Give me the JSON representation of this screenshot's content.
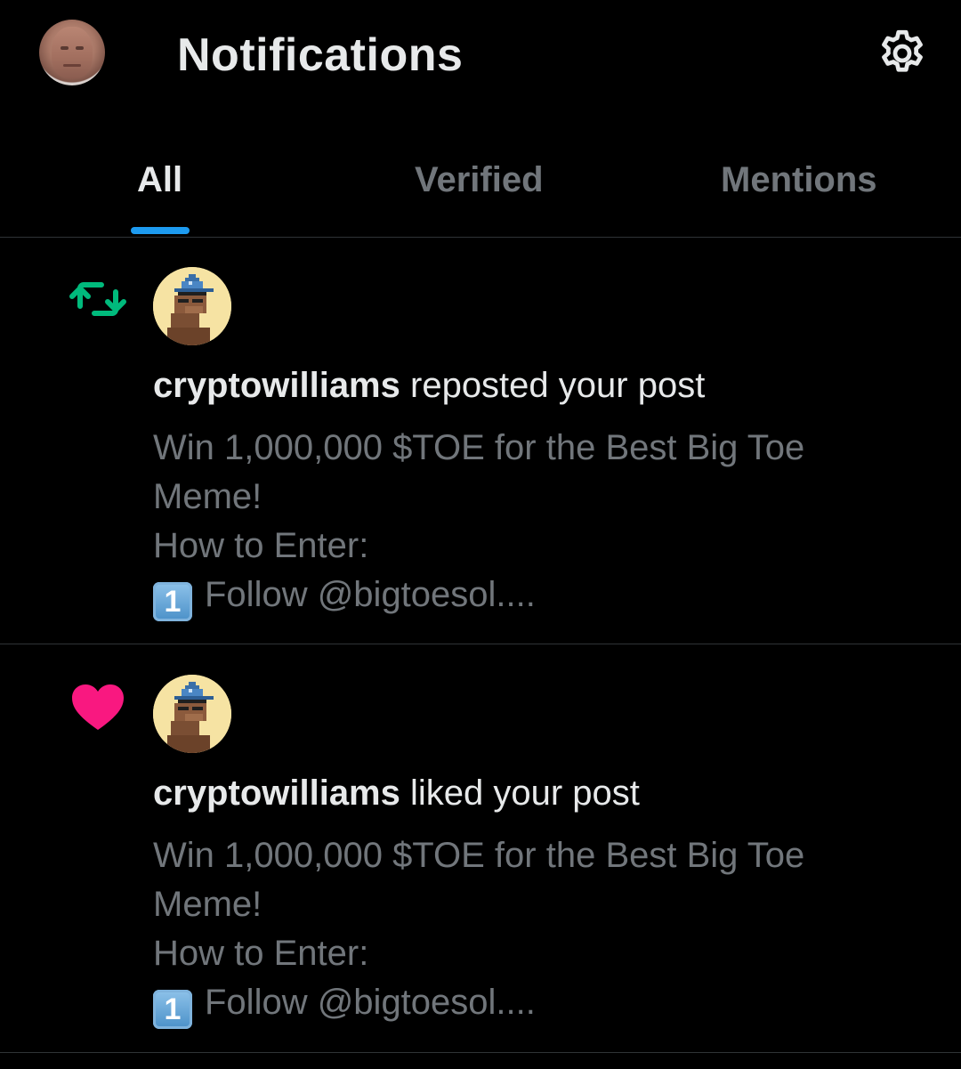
{
  "header": {
    "title": "Notifications",
    "avatar_icon": "user-avatar-icon",
    "settings_icon": "gear-icon"
  },
  "tabs": [
    {
      "label": "All",
      "active": true
    },
    {
      "label": "Verified",
      "active": false
    },
    {
      "label": "Mentions",
      "active": false
    }
  ],
  "colors": {
    "accent": "#1d9bf0",
    "repost": "#00ba7c",
    "like": "#f91880",
    "muted": "#71767b",
    "text": "#e7e9ea",
    "background": "#000000"
  },
  "notifications": [
    {
      "type_icon": "repost-icon",
      "user": "cryptowilliams",
      "action": "reposted your post",
      "body_line1": "Win 1,000,000 $TOE for the Best Big Toe Meme!",
      "body_line2": "How to Enter:",
      "keycap": "1",
      "body_line3": "Follow @bigtoesol...."
    },
    {
      "type_icon": "heart-icon",
      "user": "cryptowilliams",
      "action": "liked your post",
      "body_line1": "Win 1,000,000 $TOE for the Best Big Toe Meme!",
      "body_line2": "How to Enter:",
      "keycap": "1",
      "body_line3": "Follow @bigtoesol...."
    }
  ]
}
